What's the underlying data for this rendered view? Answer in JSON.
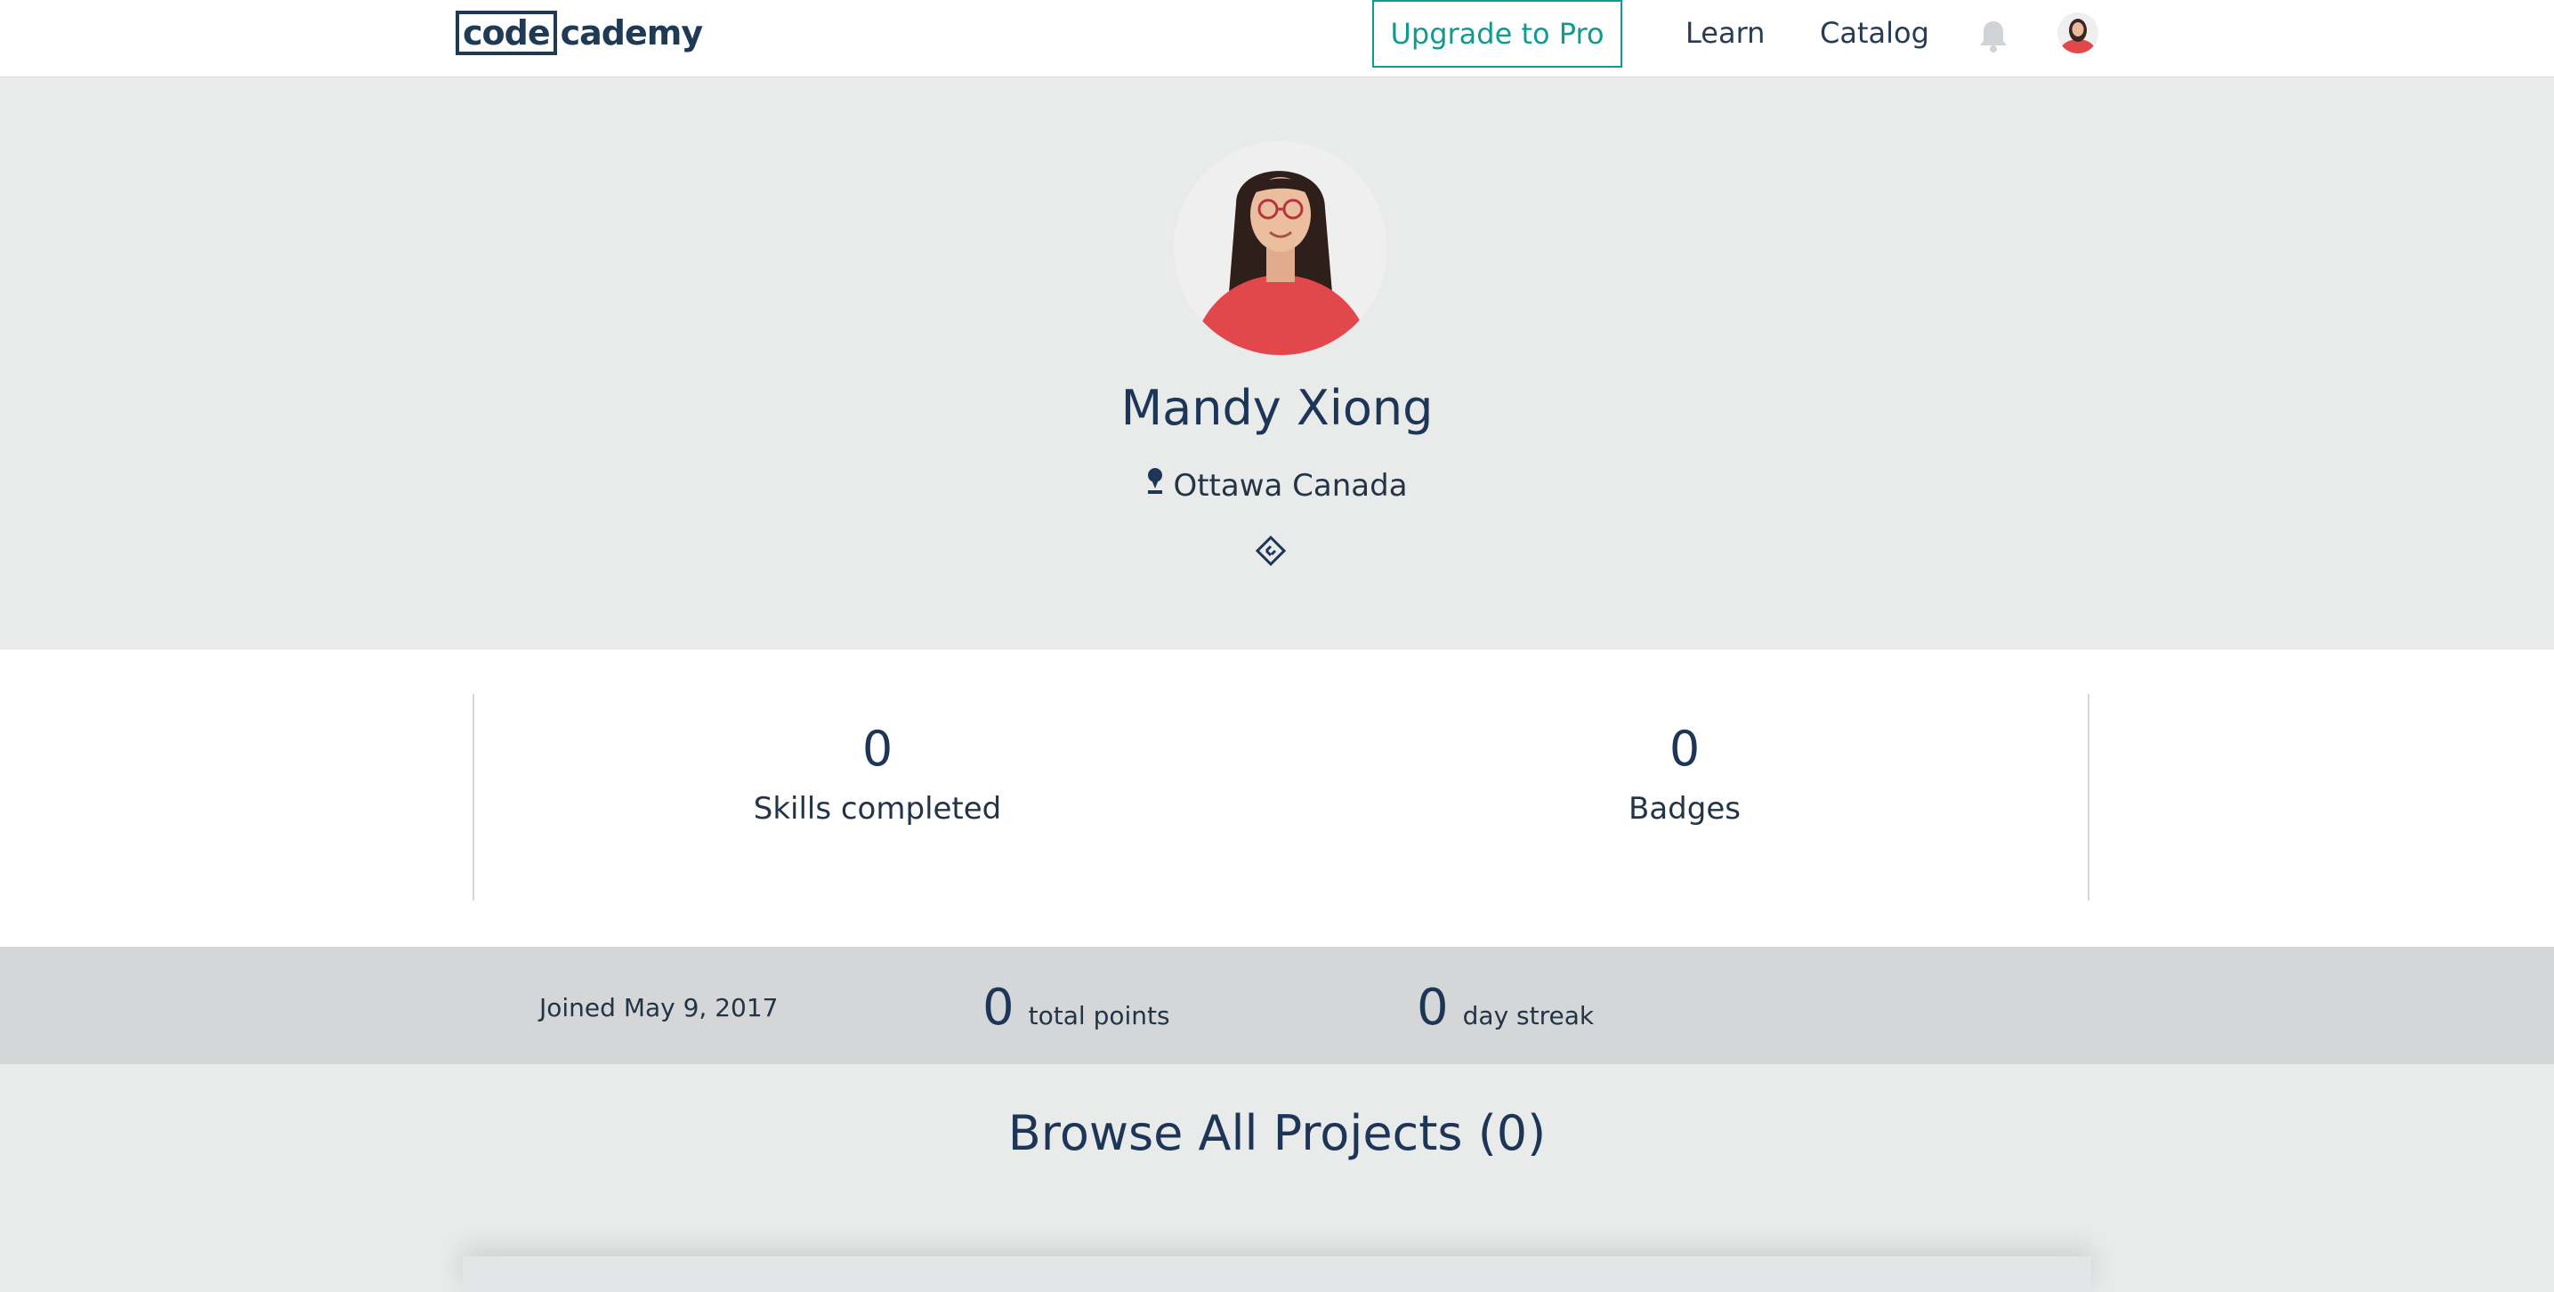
{
  "header": {
    "logo_boxed": "code",
    "logo_rest": "cademy",
    "upgrade_label": "Upgrade to Pro",
    "nav": [
      "Learn",
      "Catalog"
    ],
    "bell_icon": "bell-icon",
    "avatar_icon": "user-avatar"
  },
  "profile": {
    "name": "Mandy Xiong",
    "location": "Ottawa Canada",
    "location_icon": "map-pin-icon",
    "code_icon": "code-link-icon"
  },
  "stats": [
    {
      "value": "0",
      "label": "Skills completed"
    },
    {
      "value": "0",
      "label": "Badges"
    }
  ],
  "summary": {
    "joined": "Joined May 9, 2017",
    "points_value": "0",
    "points_label": "total points",
    "streak_value": "0",
    "streak_label": "day streak"
  },
  "projects": {
    "title": "Browse All Projects (0)"
  },
  "colors": {
    "brand_navy": "#1d3557",
    "accent_teal": "#0f9b8e",
    "avatar_shirt": "#e2484b",
    "band_gray": "#e9eaea",
    "summary_gray": "#d5d6d8"
  }
}
